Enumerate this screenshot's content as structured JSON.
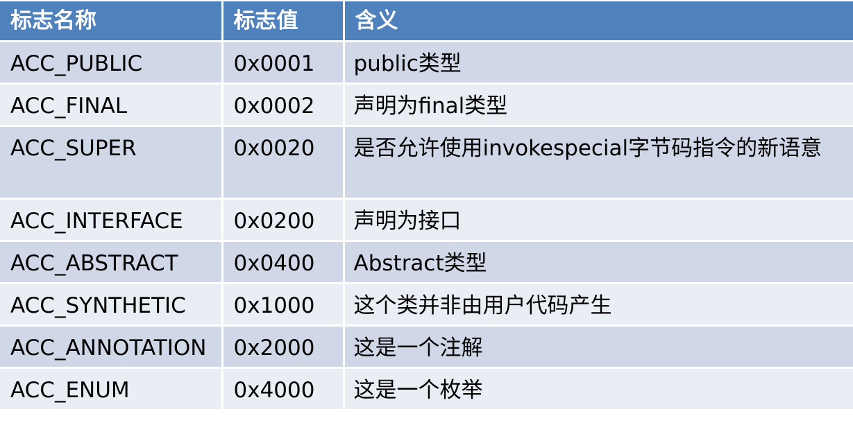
{
  "table": {
    "headers": [
      "标志名称",
      "标志值",
      "含义"
    ],
    "rows": [
      {
        "name": "ACC_PUBLIC",
        "value": "0x0001",
        "meaning": "public类型"
      },
      {
        "name": "ACC_FINAL",
        "value": "0x0002",
        "meaning": "声明为final类型"
      },
      {
        "name": "ACC_SUPER",
        "value": "0x0020",
        "meaning": "是否允许使用invokespecial字节码指令的新语意"
      },
      {
        "name": "ACC_INTERFACE",
        "value": "0x0200",
        "meaning": "声明为接口"
      },
      {
        "name": "ACC_ABSTRACT",
        "value": "0x0400",
        "meaning": "Abstract类型"
      },
      {
        "name": "ACC_SYNTHETIC",
        "value": "0x1000",
        "meaning": "这个类并非由用户代码产生"
      },
      {
        "name": "ACC_ANNOTATION",
        "value": "0x2000",
        "meaning": "这是一个注解"
      },
      {
        "name": "ACC_ENUM",
        "value": "0x4000",
        "meaning": "这是一个枚举"
      }
    ]
  },
  "colors": {
    "header_bg": "#4f81bd",
    "row_odd_bg": "#d0d8e8",
    "row_even_bg": "#e9edf4",
    "header_text": "#ffffff"
  }
}
